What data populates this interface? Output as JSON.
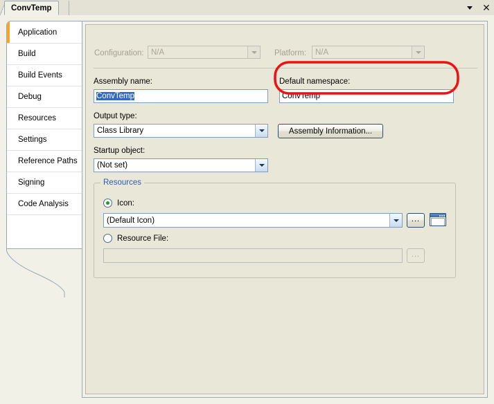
{
  "window": {
    "tab_label": "ConvTemp",
    "dropdown_icon": "chevron-down-icon",
    "close_icon": "close-x-icon"
  },
  "sidebar": {
    "items": [
      {
        "label": "Application",
        "selected": true
      },
      {
        "label": "Build",
        "selected": false
      },
      {
        "label": "Build Events",
        "selected": false
      },
      {
        "label": "Debug",
        "selected": false
      },
      {
        "label": "Resources",
        "selected": false
      },
      {
        "label": "Settings",
        "selected": false
      },
      {
        "label": "Reference Paths",
        "selected": false
      },
      {
        "label": "Signing",
        "selected": false
      },
      {
        "label": "Code Analysis",
        "selected": false
      }
    ]
  },
  "form": {
    "configuration": {
      "label": "Configuration:",
      "value": "N/A",
      "disabled": true
    },
    "platform": {
      "label": "Platform:",
      "value": "N/A",
      "disabled": true
    },
    "assembly_name": {
      "label": "Assembly name:",
      "value": "ConvTemp",
      "selected": true
    },
    "default_namespace": {
      "label": "Default namespace:",
      "value": "ConvTemp",
      "highlighted": true
    },
    "output_type": {
      "label": "Output type:",
      "value": "Class Library"
    },
    "assembly_information_button": {
      "label": "Assembly Information..."
    },
    "startup_object": {
      "label": "Startup object:",
      "value": "(Not set)"
    },
    "resources": {
      "title": "Resources",
      "icon_radio": {
        "label": "Icon:",
        "selected": true
      },
      "icon_combo": {
        "value": "(Default Icon)"
      },
      "icon_browse_button": {
        "label": "..."
      },
      "icon_preview": {
        "name": "default-icon-preview"
      },
      "resource_file_radio": {
        "label": "Resource File:",
        "selected": false
      },
      "resource_file_field": {
        "value": "",
        "disabled": true
      },
      "resource_file_browse_button": {
        "label": "...",
        "disabled": true
      }
    }
  },
  "annotation": {
    "shape": "red-ellipse-highlight",
    "color": "#ee1111",
    "target": "Default namespace"
  }
}
